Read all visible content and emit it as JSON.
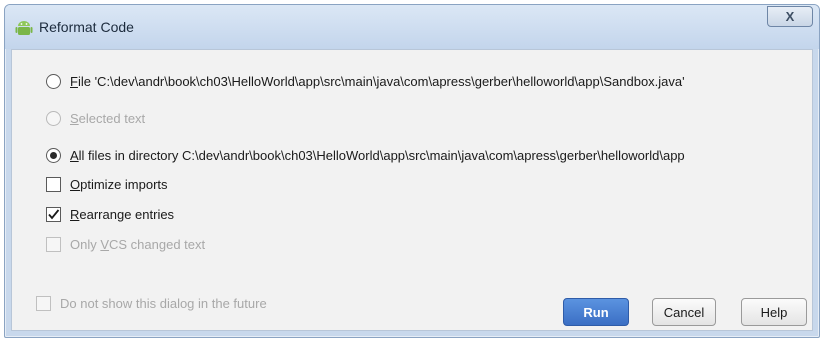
{
  "window": {
    "title": "Reformat Code",
    "close_glyph": "X"
  },
  "options": {
    "file": {
      "mnemonic": "F",
      "label_rest": "ile 'C:\\dev\\andr\\book\\ch03\\HelloWorld\\app\\src\\main\\java\\com\\apress\\gerber\\helloworld\\app\\Sandbox.java'",
      "selected": false
    },
    "selected_text": {
      "mnemonic": "S",
      "label_rest": "elected text",
      "selected": false,
      "enabled": false
    },
    "all_files": {
      "mnemonic": "A",
      "label_rest": "ll files in directory C:\\dev\\andr\\book\\ch03\\HelloWorld\\app\\src\\main\\java\\com\\apress\\gerber\\helloworld\\app",
      "selected": true
    },
    "optimize_imports": {
      "mnemonic": "O",
      "label_rest": "ptimize imports",
      "checked": false
    },
    "rearrange_entries": {
      "mnemonic": "R",
      "label_rest": "earrange entries",
      "checked": true
    },
    "only_vcs": {
      "label_before": "Only ",
      "mnemonic": "V",
      "label_rest": "CS changed text",
      "checked": false,
      "enabled": false
    },
    "do_not_show": {
      "label": "Do not show this dialog in the future",
      "checked": false,
      "enabled": false
    }
  },
  "buttons": {
    "run": "Run",
    "cancel": "Cancel",
    "help": "Help"
  },
  "colors": {
    "accent": "#3b6fc4",
    "title_bar": "#c8d8ec",
    "client_bg": "#f2f2f2",
    "disabled_text": "#a8a8a8"
  },
  "icons": {
    "app": "android-icon",
    "close": "close-icon",
    "check": "check-icon"
  }
}
